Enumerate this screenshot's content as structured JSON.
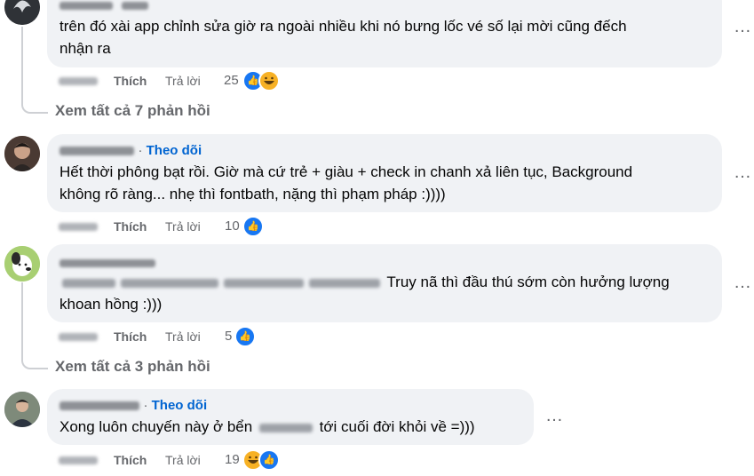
{
  "comments": [
    {
      "text_line1": "trên đó xài app chỉnh sửa giờ ra ngoài nhiều khi nó bưng lốc vé số lại mời cũng đếch",
      "text_line2": "nhận ra",
      "like_label": "Thích",
      "reply_label": "Trả lời",
      "reaction_count": "25",
      "reactions": [
        "like-icon",
        "haha-icon"
      ]
    },
    {
      "follow_label": "Theo dõi",
      "text_line1": "Hết thời phông bạt rồi. Giờ mà cứ trẻ + giàu + check in chanh xả liên tục, Background",
      "text_line2": "không rõ ràng... nhẹ thì fontbath, nặng thì phạm pháp :))))",
      "like_label": "Thích",
      "reply_label": "Trả lời",
      "reaction_count": "10",
      "reactions": [
        "like-icon"
      ]
    },
    {
      "text_line1_visible": "Truy nã thì đầu thú sớm còn hưởng lượng",
      "text_line2": "khoan hồng :)))",
      "like_label": "Thích",
      "reply_label": "Trả lời",
      "reaction_count": "5",
      "reactions": [
        "like-icon"
      ]
    },
    {
      "follow_label": "Theo dõi",
      "text_before": "Xong luôn chuyến này ở bển",
      "text_after": "tới cuối đời khỏi về =)))",
      "like_label": "Thích",
      "reply_label": "Trả lời",
      "reaction_count": "19",
      "reactions": [
        "haha-icon",
        "like-icon"
      ]
    }
  ],
  "view_replies": [
    "Xem tất cả 7 phản hồi",
    "Xem tất cả 3 phản hồi"
  ],
  "more_icon": "…",
  "colors": {
    "bubble": "#f0f2f5",
    "secondary_text": "#65676b",
    "follow_link": "#0064d1",
    "like_blue": "#1877f2",
    "haha_yellow": "#f7b125",
    "thread_line": "#ced0d4"
  }
}
